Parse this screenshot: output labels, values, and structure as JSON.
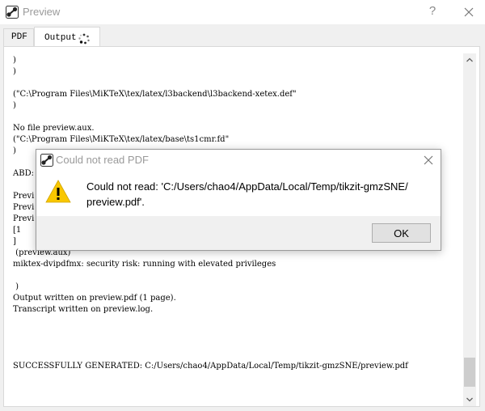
{
  "window": {
    "title": "Preview",
    "help_glyph": "?",
    "icons": {
      "app": "tikzit-app-icon",
      "close": "close-icon",
      "help": "help-icon"
    }
  },
  "tabs": [
    {
      "label": "PDF",
      "selected": false
    },
    {
      "label": "Output",
      "selected": true,
      "indicator": "loading-spinner-icon"
    }
  ],
  "output": {
    "lines": [
      ")",
      ")",
      "",
      "(\"C:\\Program Files\\MiKTeX\\tex/latex/l3backend\\l3backend-xetex.def\"",
      ")",
      "",
      "No file preview.aux.",
      "(\"C:\\Program Files\\MiKTeX\\tex/latex/base\\ts1cmr.fd\"",
      ")",
      "",
      "ABD:",
      "",
      "Previ",
      "Previ",
      "Previ",
      "[1",
      "]",
      " (preview.aux)",
      "miktex-dvipdfmx: security risk: running with elevated privileges",
      "",
      " )",
      "Output written on preview.pdf (1 page).",
      "Transcript written on preview.log.",
      "",
      "",
      "",
      "",
      "SUCCESSFULLY GENERATED: C:/Users/chao4/AppData/Local/Temp/tikzit-gmzSNE/preview.pdf"
    ]
  },
  "dialog": {
    "title": "Could not read PDF",
    "message_line1": "Could not read: 'C:/Users/chao4/AppData/Local/Temp/tikzit-gmzSNE/",
    "message_line2": "preview.pdf'.",
    "ok_label": "OK",
    "icon": "warning-icon",
    "warning_color": "#f9c700"
  }
}
